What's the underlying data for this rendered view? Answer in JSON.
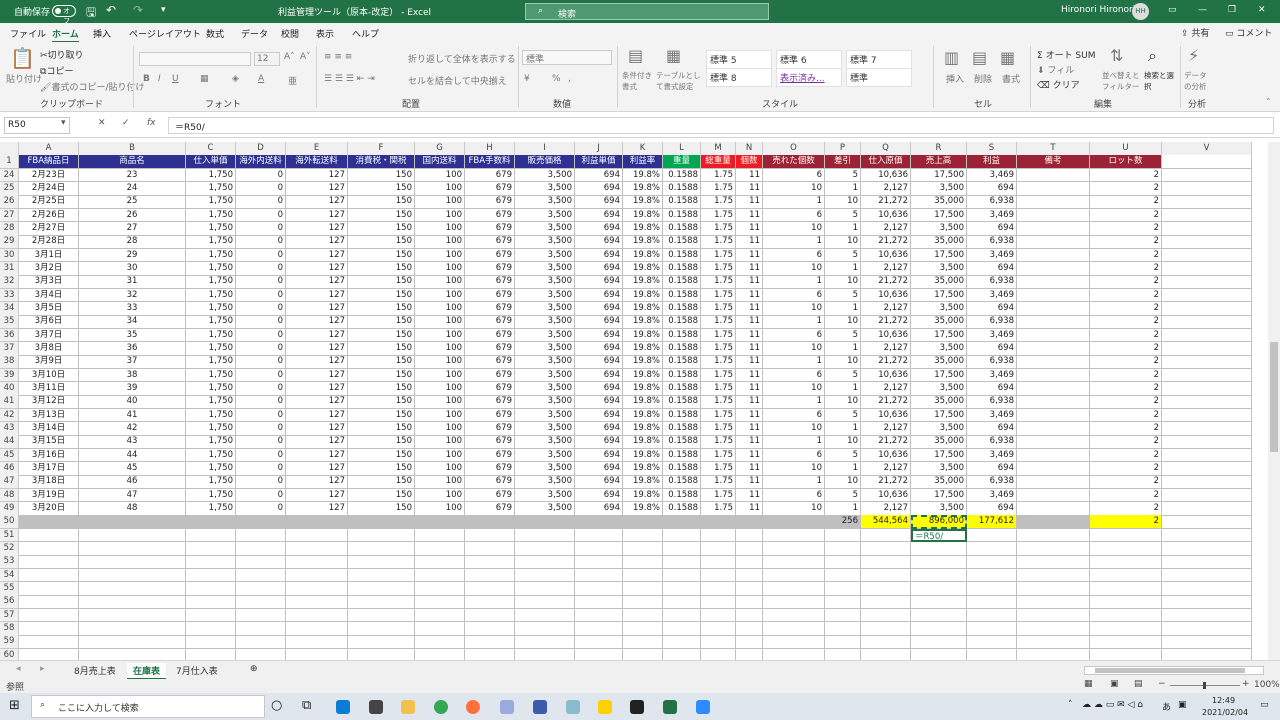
{
  "title": {
    "autosave": "自動保存",
    "autosave_state": "オフ",
    "doc": "利益管理ツール（原本-改定） - Excel",
    "search": "検索",
    "user": "Hironori Hironori",
    "initials": "HH"
  },
  "menu": [
    "ファイル",
    "ホーム",
    "挿入",
    "ページレイアウト",
    "数式",
    "データ",
    "校閲",
    "表示",
    "ヘルプ"
  ],
  "share": "共有",
  "comment": "コメント",
  "ribbon": {
    "clipboard": {
      "group": "クリップボード",
      "paste": "貼り付け",
      "cut": "切り取り",
      "copy": "コピー",
      "format_painter": "書式のコピー/貼り付け"
    },
    "font": {
      "group": "フォント",
      "size": "12"
    },
    "align": {
      "group": "配置",
      "wrap": "折り返して全体を表示する",
      "merge": "セルを結合して中央揃え"
    },
    "number": {
      "group": "数値",
      "format": "標準",
      "pct": "%",
      "comma": ","
    },
    "styles": {
      "group": "スタイル",
      "cond": "条件付き書式",
      "table": "テーブルとして書式設定",
      "cells": [
        "標準 5",
        "標準 6",
        "標準 7",
        "標準 8",
        "表示済み...",
        "標準"
      ]
    },
    "cells": {
      "group": "セル",
      "insert": "挿入",
      "delete": "削除",
      "format": "書式"
    },
    "edit": {
      "group": "編集",
      "autosum": "オート SUM",
      "fill": "フィル",
      "clear": "クリア",
      "sort": "並べ替えとフィルター",
      "find": "検索と選択"
    },
    "analysis": {
      "group": "分析",
      "data_analysis": "データの分析"
    }
  },
  "formula_bar": {
    "namebox": "R50",
    "formula": "＝R50/"
  },
  "columns": [
    "A",
    "B",
    "C",
    "D",
    "E",
    "F",
    "G",
    "H",
    "I",
    "J",
    "K",
    "L",
    "M",
    "N",
    "O",
    "P",
    "Q",
    "R",
    "S",
    "T",
    "U",
    "V"
  ],
  "headers": [
    "FBA納品日",
    "商品名",
    "仕入単価",
    "海外内送料",
    "海外転送料",
    "消費税・関税",
    "国内送料",
    "FBA手数料",
    "販売価格",
    "利益単価",
    "利益率",
    "重量",
    "総重量",
    "個数",
    "売れた個数",
    "差引",
    "仕入原価",
    "売上高",
    "利益",
    "備考",
    "ロット数",
    ""
  ],
  "rows": [
    {
      "n": "24",
      "date": "2月23日",
      "item": "23",
      "sold": "6",
      "diff": "5",
      "cost": "10,636",
      "sales": "17,500",
      "profit": "3,469"
    },
    {
      "n": "25",
      "date": "2月24日",
      "item": "24",
      "sold": "10",
      "diff": "1",
      "cost": "2,127",
      "sales": "3,500",
      "profit": "694"
    },
    {
      "n": "26",
      "date": "2月25日",
      "item": "25",
      "sold": "1",
      "diff": "10",
      "cost": "21,272",
      "sales": "35,000",
      "profit": "6,938"
    },
    {
      "n": "27",
      "date": "2月26日",
      "item": "26",
      "sold": "6",
      "diff": "5",
      "cost": "10,636",
      "sales": "17,500",
      "profit": "3,469"
    },
    {
      "n": "28",
      "date": "2月27日",
      "item": "27",
      "sold": "10",
      "diff": "1",
      "cost": "2,127",
      "sales": "3,500",
      "profit": "694"
    },
    {
      "n": "29",
      "date": "2月28日",
      "item": "28",
      "sold": "1",
      "diff": "10",
      "cost": "21,272",
      "sales": "35,000",
      "profit": "6,938"
    },
    {
      "n": "30",
      "date": "3月1日",
      "item": "29",
      "sold": "6",
      "diff": "5",
      "cost": "10,636",
      "sales": "17,500",
      "profit": "3,469"
    },
    {
      "n": "31",
      "date": "3月2日",
      "item": "30",
      "sold": "10",
      "diff": "1",
      "cost": "2,127",
      "sales": "3,500",
      "profit": "694"
    },
    {
      "n": "32",
      "date": "3月3日",
      "item": "31",
      "sold": "1",
      "diff": "10",
      "cost": "21,272",
      "sales": "35,000",
      "profit": "6,938"
    },
    {
      "n": "33",
      "date": "3月4日",
      "item": "32",
      "sold": "6",
      "diff": "5",
      "cost": "10,636",
      "sales": "17,500",
      "profit": "3,469"
    },
    {
      "n": "34",
      "date": "3月5日",
      "item": "33",
      "sold": "10",
      "diff": "1",
      "cost": "2,127",
      "sales": "3,500",
      "profit": "694"
    },
    {
      "n": "35",
      "date": "3月6日",
      "item": "34",
      "sold": "1",
      "diff": "10",
      "cost": "21,272",
      "sales": "35,000",
      "profit": "6,938"
    },
    {
      "n": "36",
      "date": "3月7日",
      "item": "35",
      "sold": "6",
      "diff": "5",
      "cost": "10,636",
      "sales": "17,500",
      "profit": "3,469"
    },
    {
      "n": "37",
      "date": "3月8日",
      "item": "36",
      "sold": "10",
      "diff": "1",
      "cost": "2,127",
      "sales": "3,500",
      "profit": "694"
    },
    {
      "n": "38",
      "date": "3月9日",
      "item": "37",
      "sold": "1",
      "diff": "10",
      "cost": "21,272",
      "sales": "35,000",
      "profit": "6,938"
    },
    {
      "n": "39",
      "date": "3月10日",
      "item": "38",
      "sold": "6",
      "diff": "5",
      "cost": "10,636",
      "sales": "17,500",
      "profit": "3,469"
    },
    {
      "n": "40",
      "date": "3月11日",
      "item": "39",
      "sold": "10",
      "diff": "1",
      "cost": "2,127",
      "sales": "3,500",
      "profit": "694"
    },
    {
      "n": "41",
      "date": "3月12日",
      "item": "40",
      "sold": "1",
      "diff": "10",
      "cost": "21,272",
      "sales": "35,000",
      "profit": "6,938"
    },
    {
      "n": "42",
      "date": "3月13日",
      "item": "41",
      "sold": "6",
      "diff": "5",
      "cost": "10,636",
      "sales": "17,500",
      "profit": "3,469"
    },
    {
      "n": "43",
      "date": "3月14日",
      "item": "42",
      "sold": "10",
      "diff": "1",
      "cost": "2,127",
      "sales": "3,500",
      "profit": "694"
    },
    {
      "n": "44",
      "date": "3月15日",
      "item": "43",
      "sold": "1",
      "diff": "10",
      "cost": "21,272",
      "sales": "35,000",
      "profit": "6,938"
    },
    {
      "n": "45",
      "date": "3月16日",
      "item": "44",
      "sold": "6",
      "diff": "5",
      "cost": "10,636",
      "sales": "17,500",
      "profit": "3,469"
    },
    {
      "n": "46",
      "date": "3月17日",
      "item": "45",
      "sold": "10",
      "diff": "1",
      "cost": "2,127",
      "sales": "3,500",
      "profit": "694"
    },
    {
      "n": "47",
      "date": "3月18日",
      "item": "46",
      "sold": "1",
      "diff": "10",
      "cost": "21,272",
      "sales": "35,000",
      "profit": "6,938"
    },
    {
      "n": "48",
      "date": "3月19日",
      "item": "47",
      "sold": "6",
      "diff": "5",
      "cost": "10,636",
      "sales": "17,500",
      "profit": "3,469"
    },
    {
      "n": "49",
      "date": "3月20日",
      "item": "48",
      "sold": "10",
      "diff": "1",
      "cost": "2,127",
      "sales": "3,500",
      "profit": "694"
    }
  ],
  "constants": {
    "unit_cost": "1,750",
    "overseas_ship": "0",
    "transfer": "127",
    "tax": "150",
    "domestic": "100",
    "fba_fee": "679",
    "price": "3,500",
    "unit_profit": "694",
    "margin": "19.8%",
    "weight": "0.1588",
    "total_weight": "1.75",
    "qty": "11",
    "lot": "2"
  },
  "total_row": {
    "n": "50",
    "diff": "256",
    "cost": "544,564",
    "sales": "896,000",
    "profit": "177,612",
    "lot": "2",
    "edit_hint": "＝R50/"
  },
  "empty_rows": [
    "51",
    "52",
    "53",
    "54",
    "55",
    "56",
    "57",
    "58",
    "59",
    "60"
  ],
  "sheets": [
    "8月売上表",
    "在庫表",
    "7月仕入表"
  ],
  "active_sheet": 1,
  "status_mode": "参照",
  "zoom": "100%",
  "taskbar": {
    "search": "ここに入力して検索",
    "time": "12:49",
    "date": "2021/02/04",
    "ime": "あ"
  },
  "colors": {
    "header_blue": "#2e3192",
    "header_green": "#00a651",
    "header_red": "#ed1c24",
    "header_dark": "#9b2335",
    "total_yellow": "#ffff00",
    "total_gray": "#bfbfbf",
    "excel_green": "#217346"
  }
}
